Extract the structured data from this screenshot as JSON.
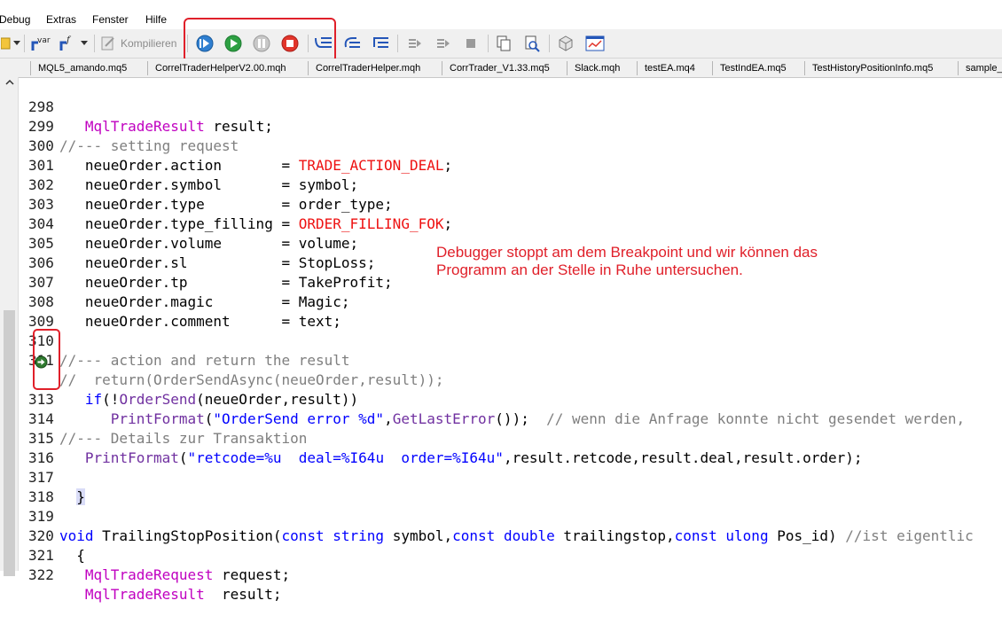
{
  "menu": [
    "Debug",
    "Extras",
    "Fenster",
    "Hilfe"
  ],
  "toolbar": {
    "var_label": "var",
    "f_label": "f",
    "compile_label": "Kompilieren"
  },
  "tabs": [
    "MQL5_amando.mq5",
    "CorrelTraderHelperV2.00.mqh",
    "CorrelTraderHelper.mqh",
    "CorrTrader_V1.33.mq5",
    "Slack.mqh",
    "testEA.mq4",
    "TestIndEA.mq5",
    "TestHistoryPositionInfo.mq5",
    "sample_"
  ],
  "code_lines": [
    {
      "n": "298",
      "text": "   MqlTradeResult result;"
    },
    {
      "n": "299",
      "text": "//--- setting request"
    },
    {
      "n": "300",
      "text": "   neueOrder.action       = TRADE_ACTION_DEAL;"
    },
    {
      "n": "301",
      "text": "   neueOrder.symbol       = symbol;"
    },
    {
      "n": "302",
      "text": "   neueOrder.type         = order_type;"
    },
    {
      "n": "303",
      "text": "   neueOrder.type_filling = ORDER_FILLING_FOK;"
    },
    {
      "n": "304",
      "text": "   neueOrder.volume       = volume;"
    },
    {
      "n": "305",
      "text": "   neueOrder.sl           = StopLoss;"
    },
    {
      "n": "306",
      "text": "   neueOrder.tp           = TakeProfit;"
    },
    {
      "n": "307",
      "text": "   neueOrder.magic        = Magic;"
    },
    {
      "n": "308",
      "text": "   neueOrder.comment      = text;"
    },
    {
      "n": "309",
      "text": ""
    },
    {
      "n": "310",
      "text": "//--- action and return the result"
    },
    {
      "n": "311",
      "text": "//  return(OrderSendAsync(neueOrder,result));"
    },
    {
      "n": "",
      "text": "   if(!OrderSend(neueOrder,result))"
    },
    {
      "n": "313",
      "text": "      PrintFormat(\"OrderSend error %d\",GetLastError());  // wenn die Anfrage konnte nicht gesendet werden,"
    },
    {
      "n": "314",
      "text": "//--- Details zur Transaktion"
    },
    {
      "n": "315",
      "text": "   PrintFormat(\"retcode=%u  deal=%I64u  order=%I64u\",result.retcode,result.deal,result.order);"
    },
    {
      "n": "316",
      "text": ""
    },
    {
      "n": "317",
      "text": "  }"
    },
    {
      "n": "318",
      "text": ""
    },
    {
      "n": "319",
      "text": "void TrailingStopPosition(const string symbol,const double trailingstop,const ulong Pos_id) //ist eigentlic"
    },
    {
      "n": "320",
      "text": "  {"
    },
    {
      "n": "321",
      "text": "   MqlTradeRequest request;"
    },
    {
      "n": "322",
      "text": "   MqlTradeResult  result;"
    }
  ],
  "annotation": {
    "line1": "Debugger stoppt am dem Breakpoint und wir können das",
    "line2": "Programm an der Stelle in Ruhe untersuchen."
  },
  "colors": {
    "keyword": "#0000ff",
    "type": "#c000c0",
    "comment": "#7f7f7f",
    "constant": "#ee1111",
    "highlight_border": "#e0202a"
  }
}
